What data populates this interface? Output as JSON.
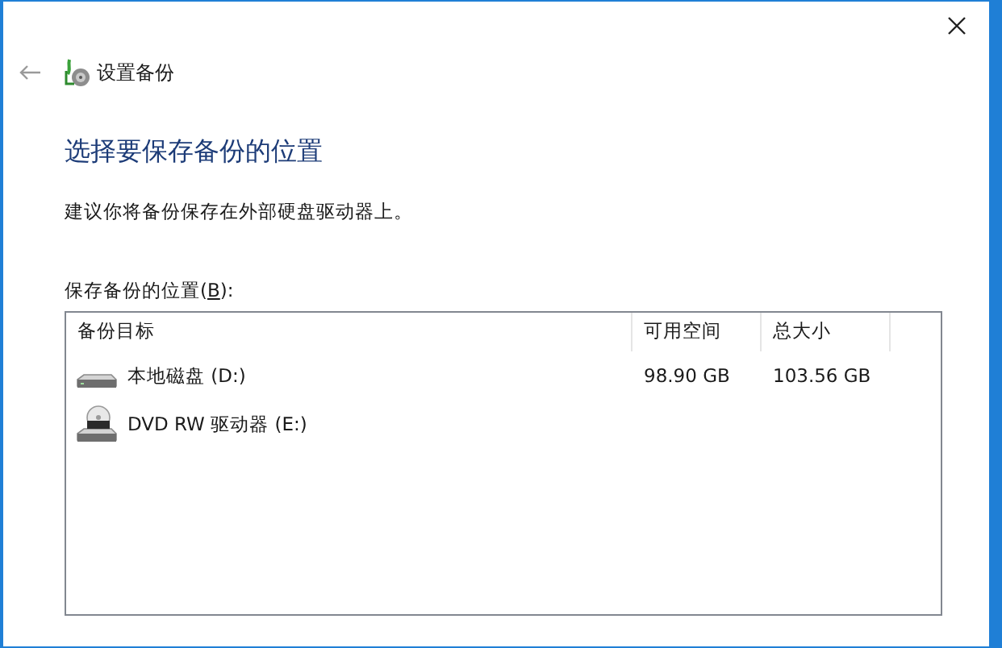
{
  "window": {
    "title": "设置备份"
  },
  "heading": "选择要保存备份的位置",
  "description": "建议你将备份保存在外部硬盘驱动器上。",
  "list_label": {
    "before": "保存备份的位置(",
    "access_key": "B",
    "after": "):"
  },
  "table": {
    "columns": [
      "备份目标",
      "可用空间",
      "总大小"
    ],
    "rows": [
      {
        "kind": "disk",
        "name": "本地磁盘 (D:)",
        "free": "98.90 GB",
        "total": "103.56 GB"
      },
      {
        "kind": "dvd",
        "name": "DVD RW 驱动器 (E:)"
      }
    ]
  }
}
